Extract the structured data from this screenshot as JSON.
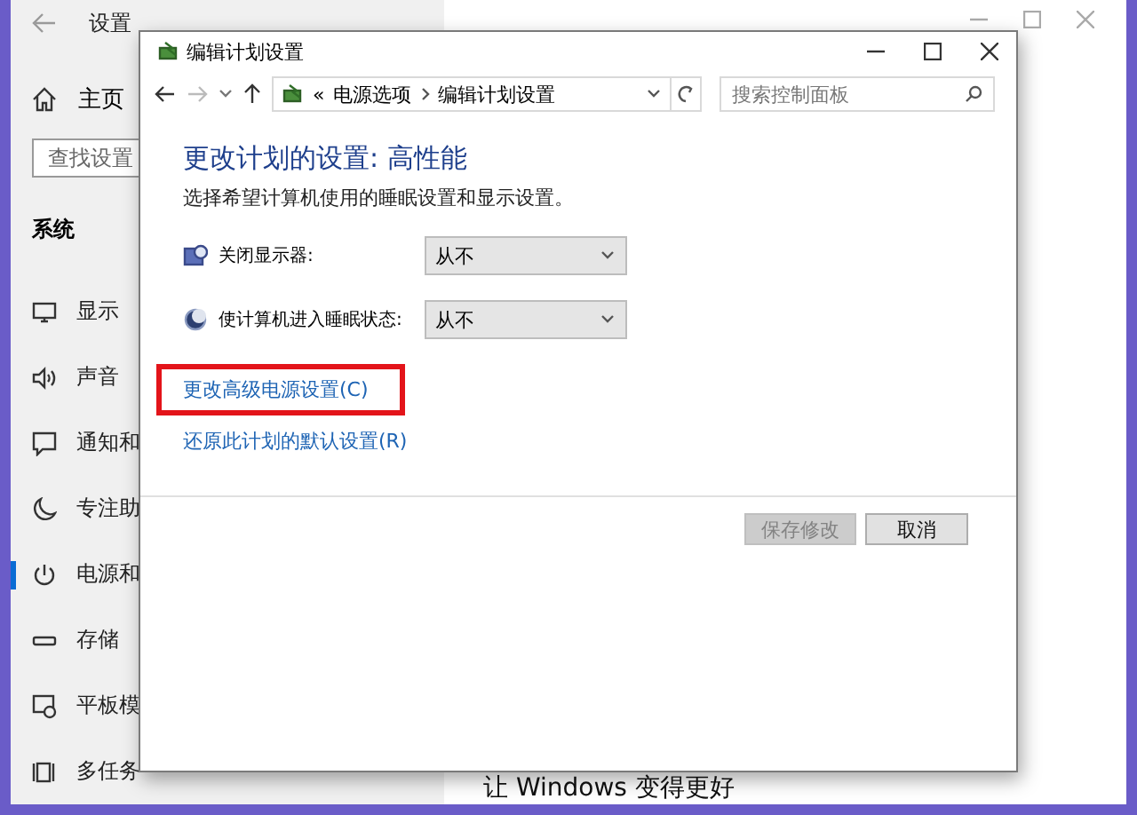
{
  "settings_window": {
    "title": "设置",
    "home": "主页",
    "search": {
      "placeholder": "查找设置"
    },
    "section": "系统",
    "nav": [
      {
        "kind": "display",
        "label": "显示",
        "selected": false
      },
      {
        "kind": "sound",
        "label": "声音",
        "selected": false
      },
      {
        "kind": "notify",
        "label": "通知和",
        "selected": false
      },
      {
        "kind": "focus",
        "label": "专注助",
        "selected": false
      },
      {
        "kind": "power",
        "label": "电源和",
        "selected": true
      },
      {
        "kind": "storage",
        "label": "存储",
        "selected": false
      },
      {
        "kind": "tablet",
        "label": "平板模",
        "selected": false
      },
      {
        "kind": "multitask",
        "label": "多任务",
        "selected": false
      }
    ],
    "footer_text": "让 Windows 变得更好"
  },
  "dialog": {
    "title": "编辑计划设置",
    "overflow": "«",
    "breadcrumb": [
      "电源选项",
      "编辑计划设置"
    ],
    "search": {
      "placeholder": "搜索控制面板"
    },
    "heading": "更改计划的设置: 高性能",
    "description": "选择希望计算机使用的睡眠设置和显示设置。",
    "settings": [
      {
        "kind": "display",
        "label": "关闭显示器:",
        "value": "从不"
      },
      {
        "kind": "sleep",
        "label": "使计算机进入睡眠状态:",
        "value": "从不"
      }
    ],
    "links": [
      {
        "text": "更改高级电源设置(C)",
        "highlighted": true
      },
      {
        "text": "还原此计划的默认设置(R)",
        "highlighted": false
      }
    ],
    "buttons": [
      {
        "label": "保存修改",
        "disabled": true
      },
      {
        "label": "取消",
        "disabled": false
      }
    ]
  }
}
